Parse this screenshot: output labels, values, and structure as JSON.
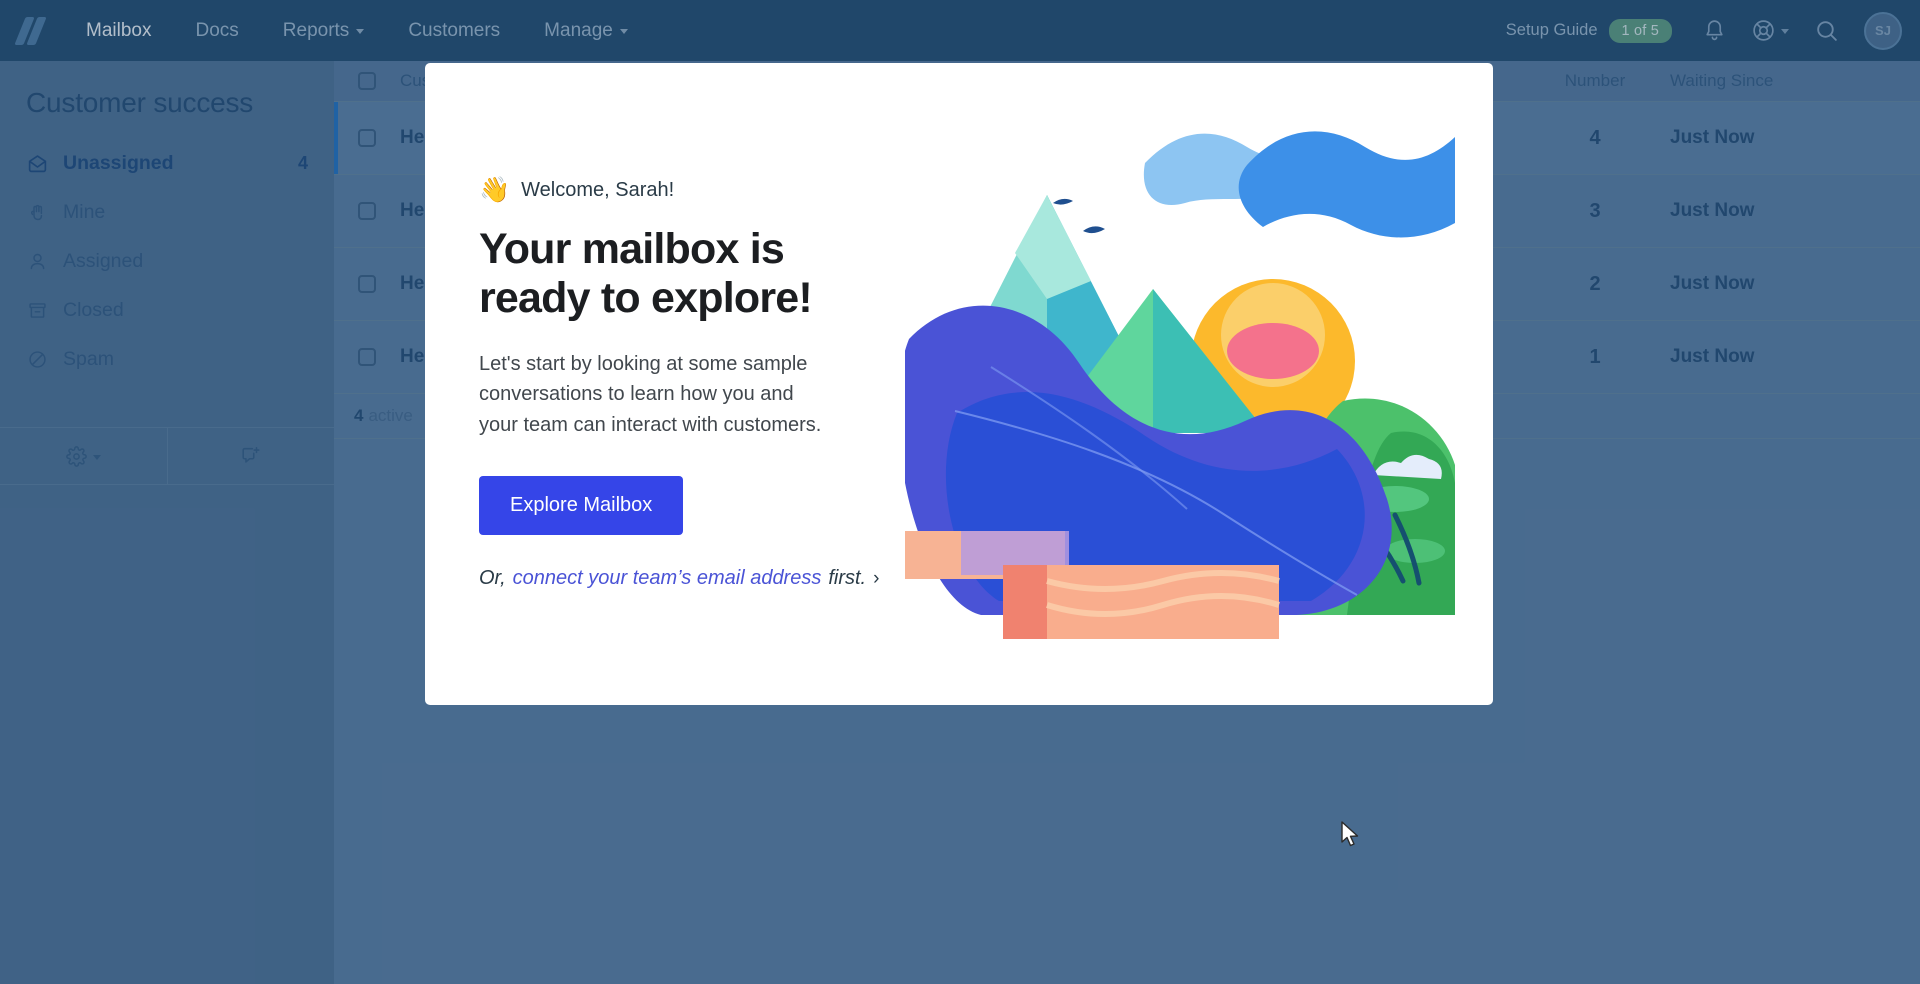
{
  "topnav": {
    "logo_name": "help-scout-logo",
    "items": [
      {
        "label": "Mailbox",
        "active": true,
        "dropdown": false
      },
      {
        "label": "Docs",
        "active": false,
        "dropdown": false
      },
      {
        "label": "Reports",
        "active": false,
        "dropdown": true
      },
      {
        "label": "Customers",
        "active": false,
        "dropdown": false
      },
      {
        "label": "Manage",
        "active": false,
        "dropdown": true
      }
    ],
    "setup_guide_label": "Setup Guide",
    "setup_guide_badge": "1 of 5",
    "setup_guide_badge_color": "#5d9e7c",
    "avatar_initials": "SJ"
  },
  "sidebar": {
    "title": "Customer success",
    "folders": [
      {
        "label": "Unassigned",
        "count": "4",
        "active": true,
        "icon": "open-envelope-icon"
      },
      {
        "label": "Mine",
        "count": "",
        "active": false,
        "icon": "hand-icon"
      },
      {
        "label": "Assigned",
        "count": "",
        "active": false,
        "icon": "person-icon"
      },
      {
        "label": "Closed",
        "count": "",
        "active": false,
        "icon": "archive-icon"
      },
      {
        "label": "Spam",
        "count": "",
        "active": false,
        "icon": "no-entry-icon"
      }
    ],
    "footer": {
      "settings_icon": "gear-icon",
      "new_conversation_icon": "new-conversation-icon"
    }
  },
  "list": {
    "columns": {
      "subject": "Customer",
      "number": "Number",
      "waiting": "Waiting Since"
    },
    "rows": [
      {
        "subject": "Help Scout would like your",
        "number": "4",
        "waiting": "Just Now",
        "selected": true
      },
      {
        "subject": "Help Scout pulls in yo",
        "number": "3",
        "waiting": "Just Now",
        "selected": false
      },
      {
        "subject": "Help Scout features",
        "number": "2",
        "waiting": "Just Now",
        "selected": false
      },
      {
        "subject": "Help Scout collaboratio",
        "number": "1",
        "waiting": "Just Now",
        "selected": false
      }
    ],
    "footer_count": "4",
    "footer_label": "active"
  },
  "modal": {
    "wave_emoji": "👋",
    "welcome": "Welcome, Sarah!",
    "heading_line1": "Your mailbox is",
    "heading_line2": "ready to explore!",
    "body": "Let's start by looking at some sample conversations to learn how you and your team can interact with customers.",
    "cta_label": "Explore Mailbox",
    "cta_color": "#3545e8",
    "alt_prefix": "Or,",
    "alt_link": "connect your team’s email address",
    "alt_suffix": "first.",
    "alt_chevron": "›",
    "illustration_name": "mountain-sunrise-illustration"
  }
}
